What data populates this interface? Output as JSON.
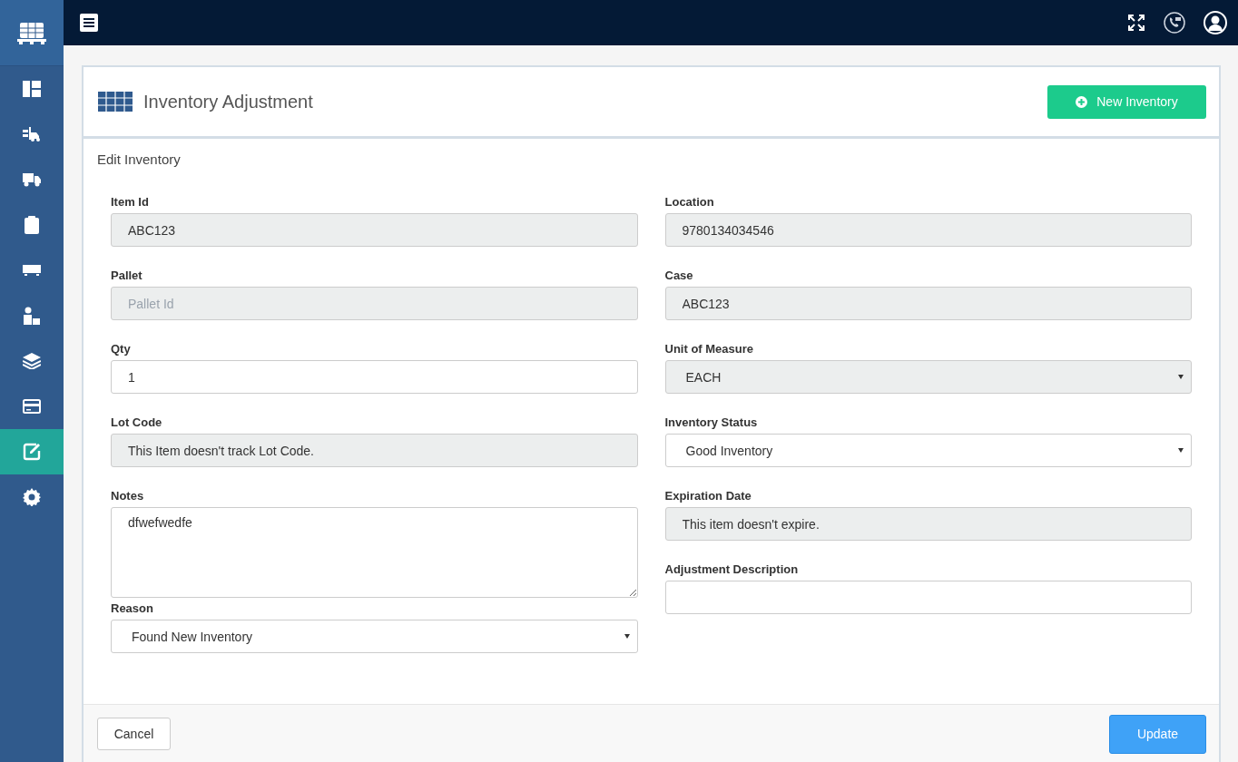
{
  "sidebar": {
    "items": [
      {
        "kind": "dashboard",
        "selected": false
      },
      {
        "kind": "forklift",
        "selected": false
      },
      {
        "kind": "truck",
        "selected": false
      },
      {
        "kind": "clipboard",
        "selected": false
      },
      {
        "kind": "trailer",
        "selected": false
      },
      {
        "kind": "worker",
        "selected": false
      },
      {
        "kind": "layers",
        "selected": false
      },
      {
        "kind": "card",
        "selected": false
      },
      {
        "kind": "edit",
        "selected": true
      },
      {
        "kind": "gear",
        "selected": false
      }
    ]
  },
  "page": {
    "title": "Inventory Adjustment",
    "new_button": "New Inventory"
  },
  "form": {
    "title": "Edit Inventory",
    "left": [
      {
        "label": "Item Id",
        "kind": "input",
        "value": "ABC123",
        "disabled": true
      },
      {
        "label": "Pallet",
        "kind": "input",
        "placeholder": "Pallet Id",
        "disabled": true
      },
      {
        "label": "Qty",
        "kind": "input",
        "value": "1",
        "disabled": false
      },
      {
        "label": "Lot Code",
        "kind": "input",
        "value": "This Item doesn't track Lot Code.",
        "disabled": true
      },
      {
        "label": "Notes",
        "kind": "textarea",
        "value": "dfwefwedfe",
        "disabled": false
      },
      {
        "label": "Reason",
        "kind": "select",
        "value": "Found New Inventory",
        "disabled": false
      }
    ],
    "right": [
      {
        "label": "Location",
        "kind": "input",
        "value": "9780134034546",
        "disabled": true
      },
      {
        "label": "Case",
        "kind": "input",
        "value": "ABC123",
        "disabled": true
      },
      {
        "label": "Unit of Measure",
        "kind": "select",
        "value": "EACH",
        "disabled": true
      },
      {
        "label": "Inventory Status",
        "kind": "select",
        "value": "Good Inventory",
        "disabled": false
      },
      {
        "label": "Expiration Date",
        "kind": "input",
        "value": "This item doesn't expire.",
        "disabled": true
      },
      {
        "label": "Adjustment Description",
        "kind": "input",
        "disabled": false
      }
    ]
  },
  "footer": {
    "cancel": "Cancel",
    "update": "Update"
  }
}
